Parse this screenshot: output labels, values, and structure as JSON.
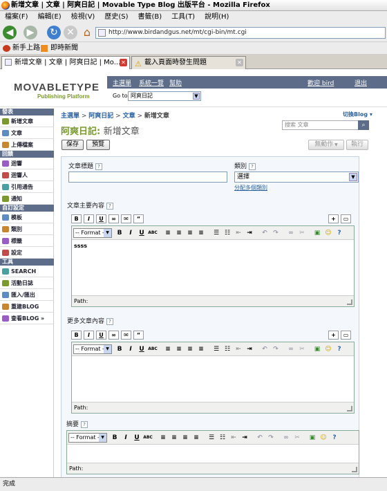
{
  "window": {
    "title": "新增文章 | 文章 | 阿爽日記 | Movable Type Blog 出版平台 - Mozilla Firefox"
  },
  "menu": [
    "檔案(F)",
    "編輯(E)",
    "檢視(V)",
    "歷史(S)",
    "書籤(B)",
    "工具(T)",
    "說明(H)"
  ],
  "url": "http://www.birdandgus.net/mt/cgi-bin/mt.cgi",
  "bookmarks": [
    "新手上路",
    "即時新聞"
  ],
  "tabs": [
    {
      "label": "新增文章 | 文章 | 阿爽日記 | Mo..."
    },
    {
      "label": "載入頁面時發生問題"
    }
  ],
  "mt": {
    "logo": "MOVABLETYPE",
    "logo_sub": "Publishing Platform",
    "top_links": [
      "主選單",
      "系統一覽",
      "幫助"
    ],
    "user_links": [
      "歡迎 bird",
      "退出"
    ],
    "goto_label": "Go to:",
    "goto_value": "阿爽日記"
  },
  "sidebar": {
    "sections": [
      {
        "title": "發表",
        "items": [
          "新增文章",
          "文章",
          "上傳檔案"
        ]
      },
      {
        "title": "回饋",
        "items": [
          "迴響",
          "迴響人",
          "引用通告",
          "通知"
        ]
      },
      {
        "title": "自訂設定",
        "items": [
          "模板",
          "類別",
          "標籤",
          "設定"
        ]
      },
      {
        "title": "工具",
        "items": [
          "SEARCH",
          "活動日誌",
          "匯入/匯出",
          "重建BLOG",
          "查看BLOG »"
        ]
      }
    ]
  },
  "breadcrumb": {
    "items": [
      "主選單",
      "阿爽日記",
      "文章",
      "新增文章"
    ],
    "sep": " > "
  },
  "switch_blog": "切換Blog ▾",
  "page_title": {
    "blog": "阿爽日記:",
    "action": "新增文章"
  },
  "search": {
    "placeholder": "搜索 文章"
  },
  "buttons": {
    "save": "保存",
    "preview": "預覽",
    "action": "無動作",
    "run": "執行"
  },
  "form": {
    "title_label": "文章標題",
    "category_label": "類別",
    "category_value": "選擇",
    "category_link": "分配多個類別",
    "body_label": "文章主要內容",
    "body_text": "ssss",
    "more_label": "更多文章內容",
    "excerpt_label": "摘要",
    "format_label": "-- Format --",
    "path_label": "Path:",
    "help": "?"
  },
  "status": "完成",
  "colors": {
    "band": "#5d6d89",
    "accent": "#7a9a2e",
    "link": "#2b63a3"
  }
}
